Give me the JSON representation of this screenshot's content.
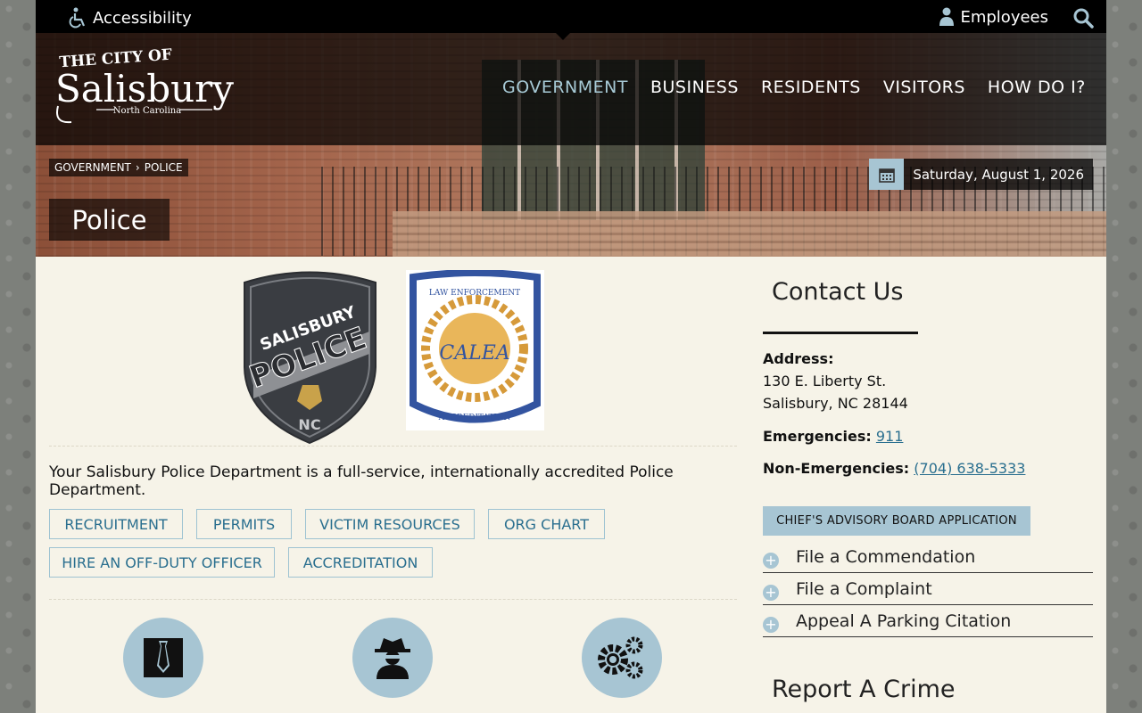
{
  "topbar": {
    "accessibility_label": "Accessibility",
    "employees_label": "Employees"
  },
  "logo": {
    "line1": "THE CITY OF",
    "line2": "Salisbury",
    "line3": "North Carolina"
  },
  "nav": {
    "items": [
      "GOVERNMENT",
      "BUSINESS",
      "RESIDENTS",
      "VISITORS",
      "HOW DO I?"
    ],
    "active": "GOVERNMENT"
  },
  "breadcrumb": {
    "items": [
      "GOVERNMENT",
      "POLICE"
    ]
  },
  "date": "Saturday, August 1, 2026",
  "page_title": "Police",
  "badges": {
    "police_text1": "SALISBURY",
    "police_text2": "POLICE",
    "police_text3": "NC",
    "calea_top": "LAW ENFORCEMENT",
    "calea_center": "CALEA",
    "calea_bottom": "ACCREDITATION"
  },
  "intro": "Your Salisbury Police Department is a full-service, internationally accredited Police Department.",
  "buttons": [
    "RECRUITMENT",
    "PERMITS",
    "VICTIM RESOURCES",
    "ORG CHART",
    "HIRE AN OFF-DUTY OFFICER",
    "ACCREDITATION"
  ],
  "sidebar": {
    "contact_title": "Contact Us",
    "address_label": "Address:",
    "address_line1": "130 E. Liberty St.",
    "address_line2": "Salisbury, NC 28144",
    "emergencies_label": "Emergencies:",
    "emergencies_value": "911",
    "non_emergencies_label": "Non-Emergencies:",
    "non_emergencies_value": "(704) 638-5333",
    "chief_button": "CHIEF'S ADVISORY BOARD APPLICATION",
    "accordion": [
      "File a Commendation",
      "File a Complaint",
      "Appeal A Parking Citation"
    ],
    "report_title": "Report A Crime"
  },
  "colors": {
    "accent": "#a7c5d3",
    "link": "#2a6f8f",
    "page_bg": "#f6f3e8"
  }
}
